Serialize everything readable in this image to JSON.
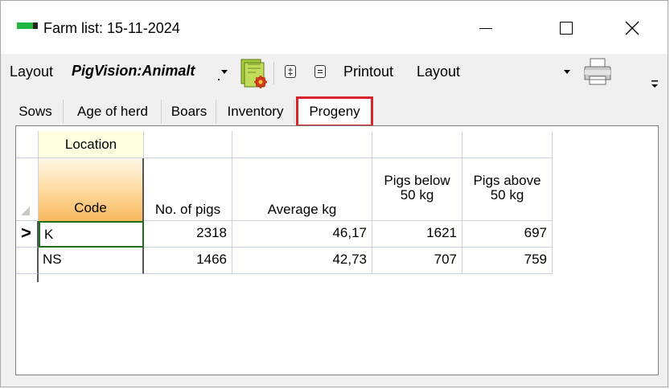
{
  "window": {
    "title": "Farm list: 15-11-2024"
  },
  "toolbar": {
    "layout_label": "Layout",
    "layout_value": "PigVision:Animalt",
    "expand_glyph": "‡",
    "collapse_glyph": "=",
    "printout_label": "Printout",
    "printout_value": "Layout"
  },
  "tabs": [
    {
      "label": "Sows"
    },
    {
      "label": "Age of herd"
    },
    {
      "label": "Boars"
    },
    {
      "label": "Inventory"
    },
    {
      "label": "Progeny",
      "active": true
    }
  ],
  "grid": {
    "group_header": "Location",
    "columns": [
      "Code",
      "No. of pigs",
      "Average kg",
      "Pigs below 50 kg",
      "Pigs above 50 kg"
    ],
    "column_lines": [
      [
        "Code"
      ],
      [
        "No. of pigs"
      ],
      [
        "Average kg"
      ],
      [
        "Pigs below",
        "50 kg"
      ],
      [
        "Pigs above",
        "50 kg"
      ]
    ],
    "current_row_marker": ">",
    "rows": [
      {
        "code": "K",
        "pigs": "2318",
        "avg": "46,17",
        "below": "1621",
        "above": "697"
      },
      {
        "code": "NS",
        "pigs": "1466",
        "avg": "42,73",
        "below": "707",
        "above": "759"
      }
    ]
  },
  "colors": {
    "accent_highlight": "#d8232a",
    "selected_cell_border": "#1e6e1e",
    "code_header_gradient": "#f5b85c",
    "location_header_bg": "#ffffe0"
  }
}
